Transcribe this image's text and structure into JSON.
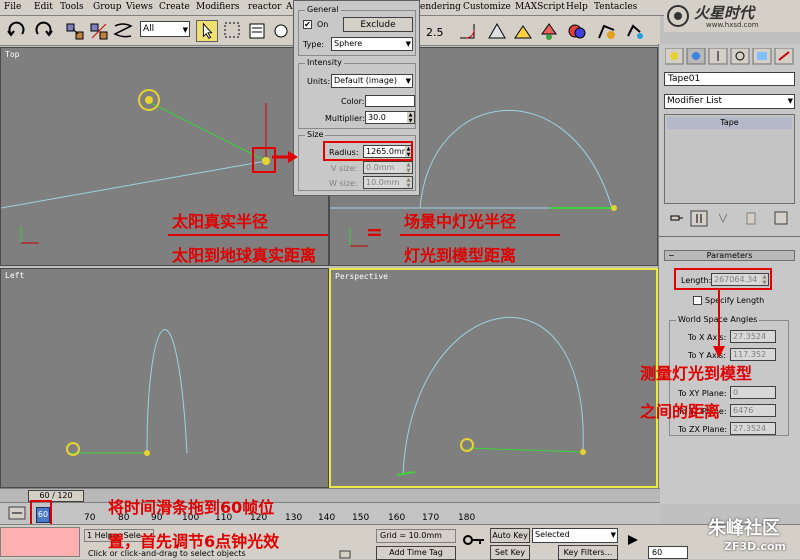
{
  "menu": [
    "File",
    "Edit",
    "Tools",
    "Group",
    "Views",
    "Create",
    "Modifiers",
    "reactor",
    "A",
    "endering",
    "Customize",
    "MAXScript",
    "Help",
    "Tentacles"
  ],
  "toolbar": {
    "filter_select": "All",
    "icons": [
      "undo-icon",
      "redo-icon",
      "link-icon",
      "unlink-icon",
      "bind-spacewarp-icon",
      "select-icon"
    ]
  },
  "viewports": {
    "top": "Top",
    "left": "Left",
    "perspective": "Perspective"
  },
  "general_panel": {
    "general_title": "General",
    "on_label": "On",
    "on_checked": "✔",
    "exclude_label": "Exclude",
    "type_label": "Type:",
    "type_value": "Sphere",
    "intensity_title": "Intensity",
    "units_label": "Units:",
    "units_value": "Default (image)",
    "color_label": "Color:",
    "multiplier_label": "Multiplier:",
    "multiplier_value": "30.0",
    "size_title": "Size",
    "radius_label": "Radius:",
    "radius_value": "1265.0mm",
    "vsize_label": "V size:",
    "vsize_value": "0.0mm",
    "wsize_label": "W size:",
    "wsize_value": "10.0mm"
  },
  "cmd_panel": {
    "object_name": "Tape01",
    "modifier_list": "Modifier List",
    "stack_item": "Tape",
    "parameters_title": "Parameters",
    "length_label": "Length:",
    "length_value": "267064.34",
    "specify_length": "Specify Length",
    "wsa_title": "World Space Angles",
    "to_x_axis_label": "To X Axis:",
    "to_x_axis_value": "27.3524",
    "to_y_axis_label": "To Y Axis:",
    "to_y_axis_value": "117.352",
    "to_xy_plane_label": "To XY Plane:",
    "to_xy_plane_value": "0",
    "to_yz_plane_label": "To YZ Plane:",
    "to_yz_plane_value": "6476",
    "to_zx_plane_label": "To ZX Plane:",
    "to_zx_plane_value": "27.3524"
  },
  "annotations": {
    "sun_radius": "太阳真实半径",
    "sun_distance": "太阳到地球真实距离",
    "equals": "=",
    "scene_light_radius": "场景中灯光半径",
    "light_model_distance": "灯光到模型距离",
    "measure_line1": "测量灯光到模型",
    "measure_line2": "之间的距离",
    "drag_slider": "将时间滑条拖到60帧位",
    "first_step": "置，首先调节6点钟光效"
  },
  "timeline": {
    "slider_label": "60 / 120",
    "frame_box": "60",
    "ticks": [
      "70",
      "80",
      "90",
      "100",
      "110",
      "120",
      "130",
      "140",
      "150",
      "160",
      "170",
      "180"
    ]
  },
  "status": {
    "selection": "1 Helper Sele",
    "prompt": "Click or click-and-drag to select objects",
    "grid": "Grid = 10.0mm",
    "add_time_tag": "Add Time Tag",
    "auto_key": "Auto Key",
    "set_key": "Set Key",
    "selected": "Selected",
    "key_filters": "Key Filters...",
    "frame": "60"
  },
  "watermark": {
    "top_logo": "火星时代",
    "top_url": "www.hxsd.com",
    "bottom_logo": "朱峰社区",
    "bottom_url": "ZF3D.com"
  },
  "colors": {
    "annotation": "#e00000",
    "viewport_bg": "#7f7f7f",
    "active_border": "#e8e84a",
    "spline": "#9ad4e0",
    "tape": "#3cd23c"
  }
}
